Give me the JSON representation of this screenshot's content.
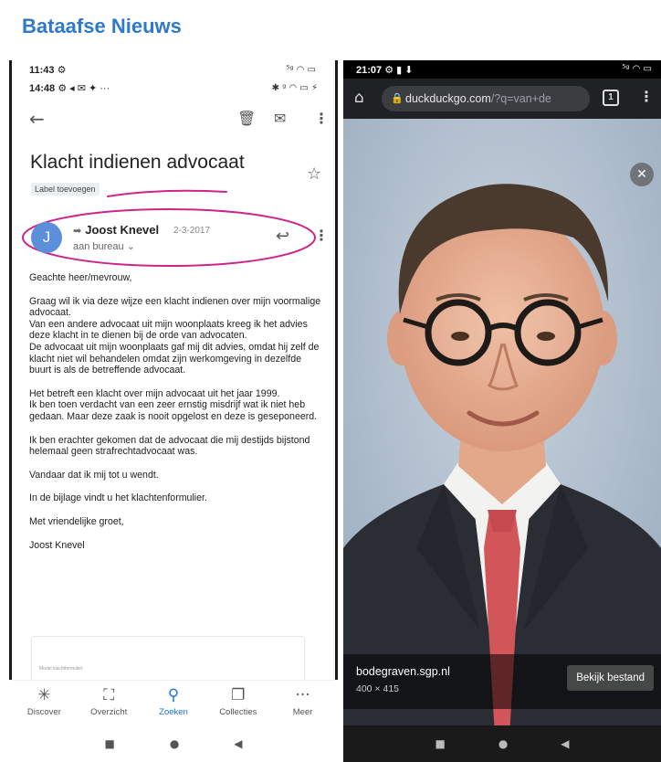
{
  "brand": "Bataafse Nieuws",
  "left": {
    "status_outer": {
      "time": "11:43",
      "icons": "⚙",
      "right": "⁵ᵍ ◠ ▭"
    },
    "status_inner": {
      "time": "14:48",
      "icons": "⚙ ◂ ✉ ✦ ···",
      "right": "✱ ᵍ ◠ ▭ ⚡"
    },
    "subject": "Klacht indienen advocaat",
    "label_chip": "Label toevoegen",
    "avatar_letter": "J",
    "sender": "Joost Knevel",
    "date": "2-3-2017",
    "recipient": "aan bureau",
    "paragraphs": [
      "Geachte heer/mevrouw,",
      "Graag wil ik via deze wijze een klacht indienen over mijn voormalige advocaat.\nVan een andere advocaat uit mijn woonplaats kreeg ik het advies deze klacht in te dienen bij de orde van advocaten.\nDe advocaat uit mijn woonplaats gaf mij dit advies, omdat hij zelf de klacht niet wil behandelen omdat zijn werkomgeving in dezelfde buurt is als de betreffende advocaat.",
      "Het betreft een klacht over mijn advocaat uit het jaar 1999.\nIk ben toen verdacht van een zeer ernstig misdrijf wat ik niet heb gedaan. Maar deze zaak is nooit opgelost en deze is geseponeerd.",
      "Ik ben erachter gekomen dat de advocaat die mij destijds bijstond helemaal geen strafrechtadvocaat was.",
      "Vandaar dat ik mij tot u wendt.",
      "In de bijlage vindt u het klachtenformulier.",
      "Met vriendelijke groet,",
      "Joost Knevel"
    ],
    "attachment_caption": "Model klachtformulier",
    "nav": [
      {
        "label": "Discover",
        "icon": "✳"
      },
      {
        "label": "Overzicht",
        "icon": "⛶"
      },
      {
        "label": "Zoeken",
        "icon": "⚲"
      },
      {
        "label": "Collecties",
        "icon": "❐"
      },
      {
        "label": "Meer",
        "icon": "···"
      }
    ],
    "sys_nav": [
      "■",
      "●",
      "◀"
    ]
  },
  "right": {
    "status": {
      "time": "21:07",
      "icons": "⚙ ▮ ⬇",
      "right": "⁵ᵍ ◠ ▭"
    },
    "url_main": "duckduckgo.com",
    "url_rest": "/?q=van+de",
    "tab_count": "1",
    "image_source": "bodegraven.sgp.nl",
    "image_size": "400 × 415",
    "view_file_button": "Bekijk bestand",
    "sys_nav": [
      "■",
      "●",
      "◀"
    ],
    "colors": {
      "tie": "#d2555a",
      "suit": "#2a2d34",
      "background": "#b8c4d2",
      "annotation": "#d0238a"
    }
  }
}
